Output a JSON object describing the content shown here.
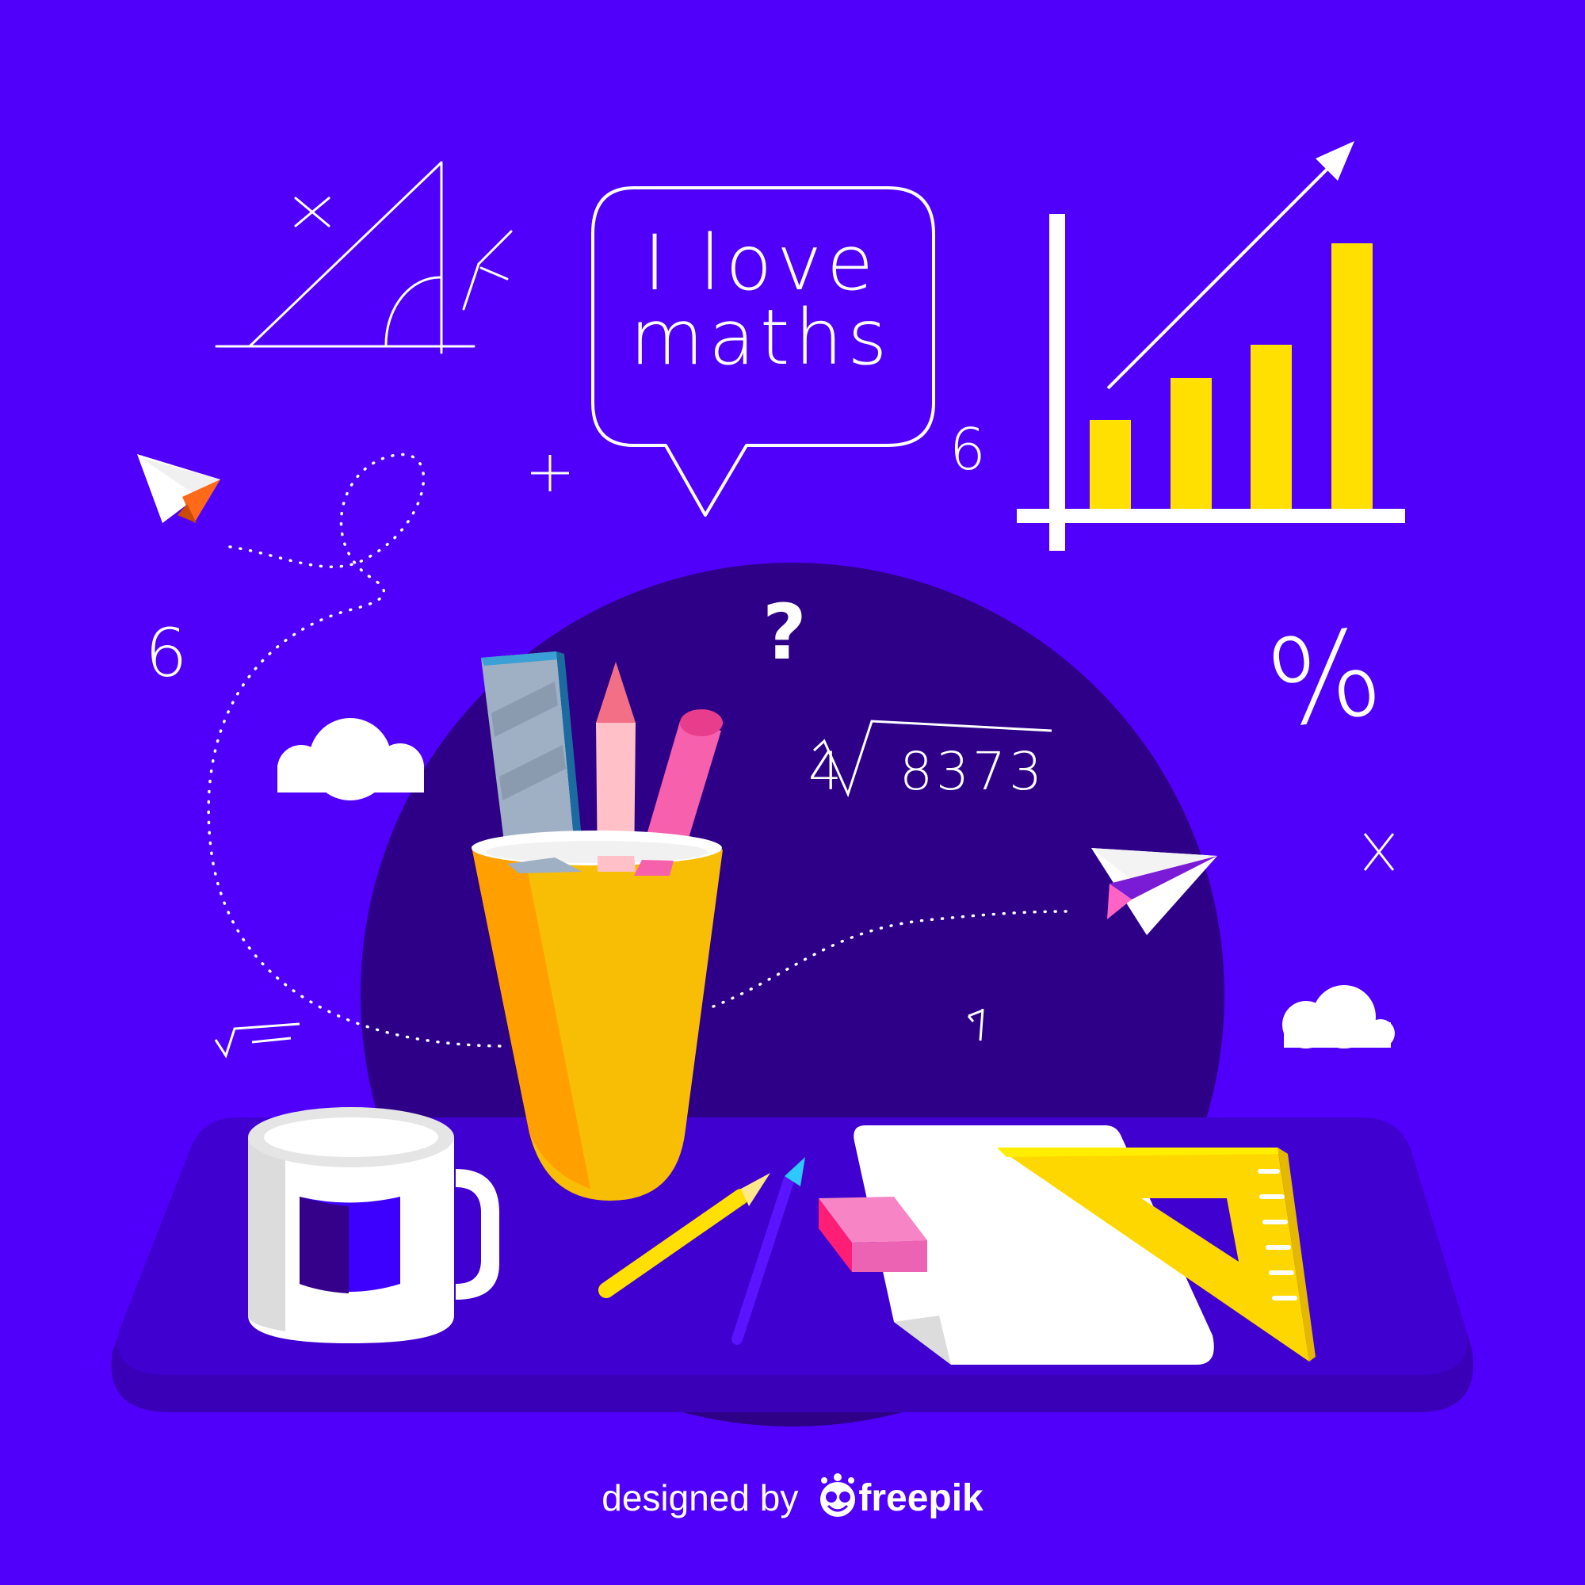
{
  "speech_bubble": {
    "line1": "I love",
    "line2": "maths"
  },
  "symbols": {
    "question": "?",
    "six_a": "6",
    "six_b": "6",
    "percent": "%",
    "root_index": "4",
    "root_radicand": "8373"
  },
  "credit": {
    "prefix": "designed by",
    "brand": "freepik"
  },
  "colors": {
    "background": "#5000fa",
    "circle": "#2d0087",
    "desk": "#3a00cc",
    "cup": "#f6b400",
    "chart_bar": "#ffe000",
    "set_square": "#ffd700"
  },
  "icons": [
    "triangle-sketch-icon",
    "bar-chart-icon",
    "paper-plane-icon",
    "cloud-icon",
    "cup-icon",
    "ruler-icon",
    "pencil-icon",
    "mug-icon",
    "eraser-icon",
    "paper-sheet-icon",
    "set-square-icon",
    "freepik-logo-icon"
  ]
}
